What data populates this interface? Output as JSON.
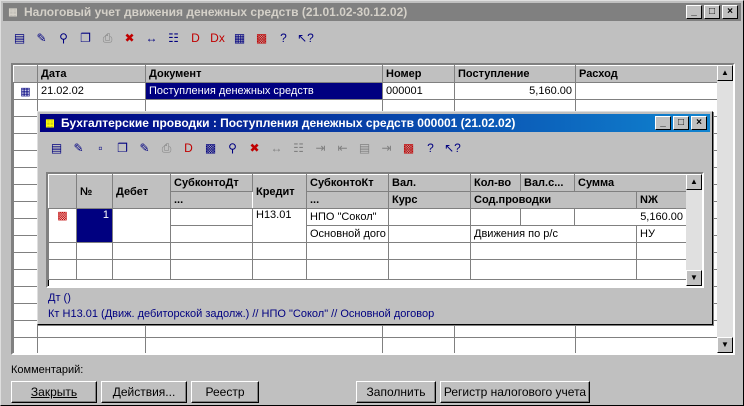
{
  "main_window": {
    "title": "Налоговый учет движения денежных средств (21.01.02-30.12.02)",
    "controls": [
      "_",
      "□",
      "×"
    ],
    "toolbar_icons": [
      "new-doc-icon",
      "edit-icon",
      "find-icon",
      "copy-icon",
      "print-icon",
      "delete-icon",
      "range-icon",
      "tree-icon",
      "post-icon",
      "unpost-icon",
      "journal-icon",
      "report-icon",
      "help-icon",
      "context-help-icon"
    ],
    "columns": [
      "Дата",
      "Документ",
      "Номер",
      "Поступление",
      "Расход"
    ],
    "rows": [
      {
        "date": "21.02.02",
        "document": "Поступления денежных средств",
        "number": "000001",
        "income": "5,160.00",
        "expense": ""
      }
    ]
  },
  "child_window": {
    "title": "Бухгалтерские проводки  : Поступления денежных средств 000001 (21.02.02)",
    "controls": [
      "_",
      "□",
      "×"
    ],
    "header": {
      "row1": [
        "№",
        "Дебет",
        "СубконтоДт",
        "Кредит",
        "СубконтоКт",
        "Вал.",
        "Кол-во",
        "Вал.с...",
        "Сумма"
      ],
      "row2": [
        "...",
        "...",
        "Курс",
        "Сод.проводки",
        "NЖ"
      ]
    },
    "entry": {
      "n": "1",
      "debit": "",
      "credit": "Н13.01",
      "subconto_kt_1": "НПО \"Сокол\"",
      "subconto_kt_2": "Основной дого",
      "sum": "5,160.00",
      "content": "Движения по р/с",
      "nj": "НУ"
    },
    "info_dt": "Дт ()",
    "info_kt": "Кт Н13.01 (Движ. дебиторской задолж.) // НПО \"Сокол\" // Основной договор"
  },
  "comment_label": "Комментарий:",
  "buttons": {
    "close": "Закрыть",
    "actions": "Действия...",
    "register": "Реестр",
    "fill": "Заполнить",
    "tax_register": "Регистр налогового учета"
  }
}
